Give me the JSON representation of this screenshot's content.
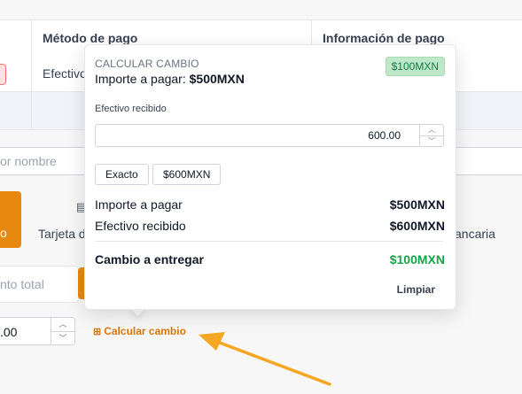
{
  "table": {
    "headers": [
      "Método de pago",
      "Información de pago"
    ],
    "row1_method": "Efectivo"
  },
  "search": {
    "placeholder_text": "or nombre"
  },
  "payment_options": {
    "orange_label": "o",
    "tarjeta_label": "Tarjeta d",
    "bancaria_label": "ancaria"
  },
  "monto": {
    "placeholder_text": "nto total"
  },
  "received_input": {
    "value": ".00"
  },
  "calc_link": {
    "label": "Calcular cambio"
  },
  "popover": {
    "title": "CALCULAR CAMBIO",
    "amount_prefix": "Importe a pagar:",
    "amount_value": "$500MXN",
    "change_pill": "$100MXN",
    "received_label": "Efectivo recibido",
    "received_value": "600.00",
    "quick_buttons": [
      "Exacto",
      "$600MXN"
    ],
    "summary": [
      {
        "label": "Importe a pagar",
        "value": "$500MXN"
      },
      {
        "label": "Efectivo recibido",
        "value": "$600MXN"
      }
    ],
    "change_label": "Cambio a entregar",
    "change_value": "$100MXN",
    "clear_label": "Limpiar"
  },
  "colors": {
    "accent_orange": "#e8890f",
    "green": "#16a34a",
    "arrow": "#f5a623"
  }
}
